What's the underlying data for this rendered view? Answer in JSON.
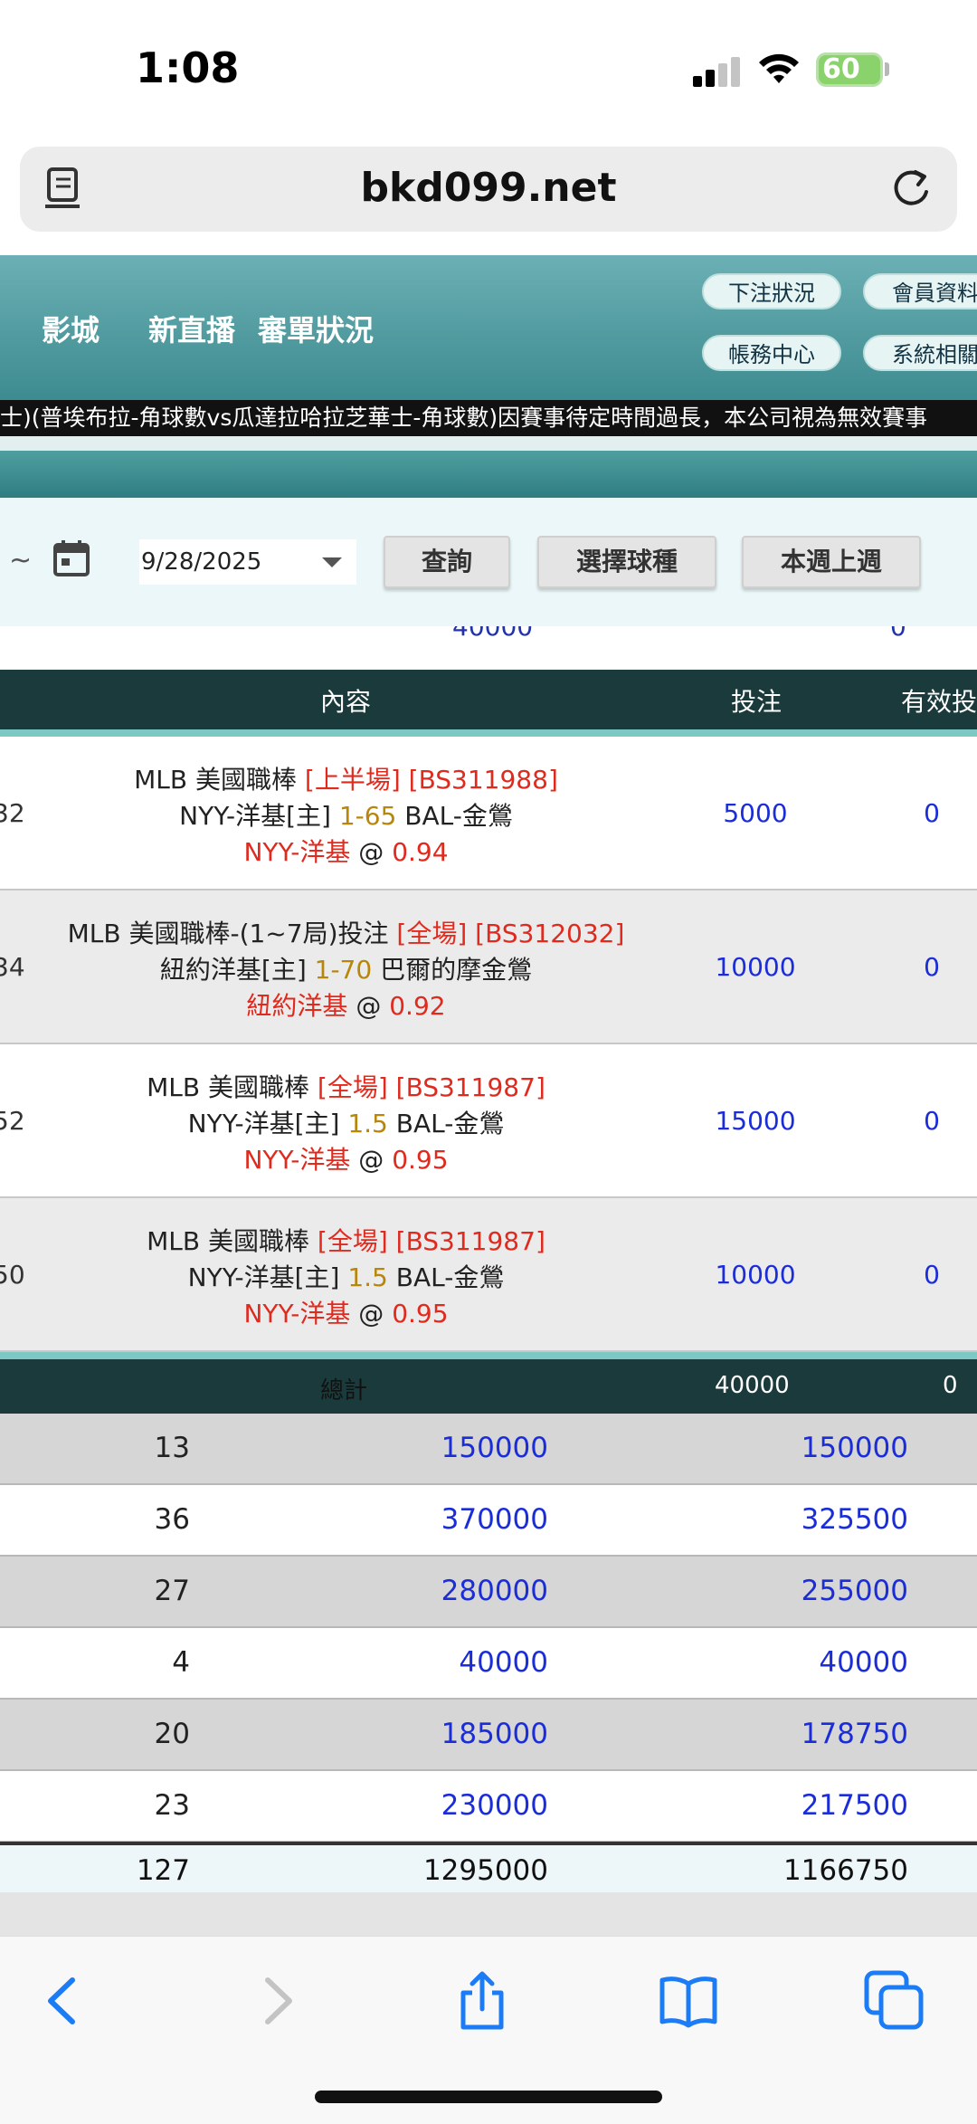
{
  "status_bar": {
    "time": "1:08",
    "battery": "60"
  },
  "browser": {
    "url": "bkd099.net"
  },
  "header": {
    "nav": [
      "影城",
      "新直播",
      "審單狀況"
    ],
    "pills": [
      "下注狀況",
      "會員資料",
      "帳務中心",
      "系統相關"
    ]
  },
  "ticker": "士)(普埃布拉-角球數vs瓜達拉哈拉芝華士-角球數)因賽事待定時間過長，本公司視為無效賽事",
  "filter": {
    "tilde": "~",
    "date": "9/28/2025",
    "buttons": [
      "查詢",
      "選擇球種",
      "本週上週"
    ]
  },
  "partial_row": {
    "amount": "40000",
    "valid": "0"
  },
  "bet_table": {
    "headers": {
      "content": "內容",
      "bet": "投注",
      "valid": "有效投"
    },
    "rows": [
      {
        "id": "32",
        "l1a": "MLB 美國職棒 ",
        "l1b": "[上半場] [BS311988]",
        "l2a": "NYY-洋基[主] ",
        "l2b": "1-65",
        "l2c": " BAL-金鶯",
        "l3a": "NYY-洋基",
        "l3b": " @ ",
        "l3c": "0.94",
        "amount": "5000",
        "valid": "0"
      },
      {
        "id": "34",
        "l1a": "MLB 美國職棒-(1~7局)投注 ",
        "l1b": "[全場] [BS312032]",
        "l2a": "紐約洋基[主] ",
        "l2b": "1-70",
        "l2c": " 巴爾的摩金鶯",
        "l3a": "紐約洋基",
        "l3b": " @ ",
        "l3c": "0.92",
        "amount": "10000",
        "valid": "0"
      },
      {
        "id": "52",
        "l1a": "MLB 美國職棒 ",
        "l1b": "[全場] [BS311987]",
        "l2a": "NYY-洋基[主] ",
        "l2b": "1.5",
        "l2c": " BAL-金鶯",
        "l3a": "NYY-洋基",
        "l3b": " @ ",
        "l3c": "0.95",
        "amount": "15000",
        "valid": "0"
      },
      {
        "id": "50",
        "l1a": "MLB 美國職棒 ",
        "l1b": "[全場] [BS311987]",
        "l2a": "NYY-洋基[主] ",
        "l2b": "1.5",
        "l2c": " BAL-金鶯",
        "l3a": "NYY-洋基",
        "l3b": " @ ",
        "l3c": "0.95",
        "amount": "10000",
        "valid": "0"
      }
    ],
    "total": {
      "label": "總計",
      "amount": "40000",
      "valid": "0"
    }
  },
  "summary": {
    "rows": [
      {
        "count": "13",
        "bet": "150000",
        "valid": "150000"
      },
      {
        "count": "36",
        "bet": "370000",
        "valid": "325500"
      },
      {
        "count": "27",
        "bet": "280000",
        "valid": "255000"
      },
      {
        "count": "4",
        "bet": "40000",
        "valid": "40000"
      },
      {
        "count": "20",
        "bet": "185000",
        "valid": "178750"
      },
      {
        "count": "23",
        "bet": "230000",
        "valid": "217500"
      }
    ],
    "grand": {
      "count": "127",
      "bet": "1295000",
      "valid": "1166750"
    }
  },
  "icons": [
    "reader-icon",
    "reload-icon",
    "calendar-icon",
    "back-icon",
    "forward-icon",
    "share-icon",
    "bookmarks-icon",
    "tabs-icon"
  ]
}
